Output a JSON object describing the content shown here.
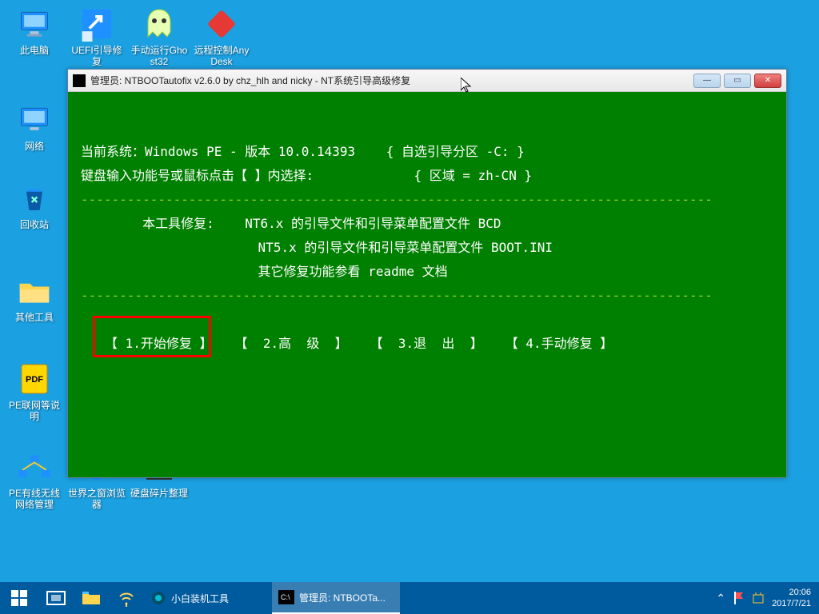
{
  "desktop": {
    "icons": [
      {
        "label": "此电脑"
      },
      {
        "label": "UEFI引导修复"
      },
      {
        "label": "手动运行Ghost32"
      },
      {
        "label": "远程控制AnyDesk"
      },
      {
        "label": "网络"
      },
      {
        "label": "回收站"
      },
      {
        "label": "其他工具"
      },
      {
        "label": "PE联网等说明"
      },
      {
        "label": "PE有线无线网络管理"
      },
      {
        "label": "世界之窗浏览器"
      },
      {
        "label": "硬盘碎片整理"
      }
    ]
  },
  "window": {
    "title": "管理员: NTBOOTautofix v2.6.0 by chz_hlh and nicky - NT系统引导高级修复",
    "lines": {
      "l1": "当前系统：Windows PE - 版本 10.0.14393    { 自选引导分区 -C: }",
      "l2": "键盘输入功能号或鼠标点击【 】内选择:             { 区域 = zh-CN }",
      "sep": "----------------------------------------------------------------------------------",
      "l3": "        本工具修复:    NT6.x 的引导文件和引导菜单配置文件 BCD",
      "l4": "                       NT5.x 的引导文件和引导菜单配置文件 BOOT.INI",
      "l5": "                       其它修复功能参看 readme 文档"
    },
    "menu": {
      "m1": "【 1.开始修复 】",
      "m2": "【  2.高  级  】",
      "m3": "【  3.退  出  】",
      "m4": "【 4.手动修复 】"
    }
  },
  "taskbar": {
    "task1": "小白装机工具",
    "task2": "管理员: NTBOOTa...",
    "time": "20:06",
    "date": "2017/7/21"
  }
}
